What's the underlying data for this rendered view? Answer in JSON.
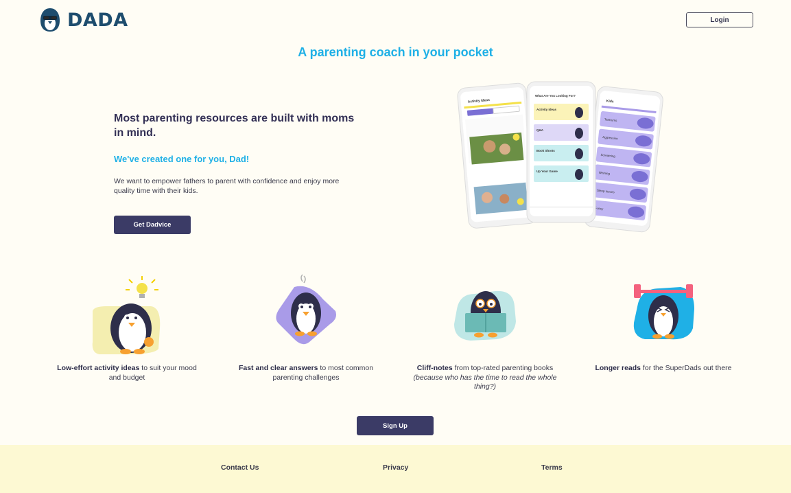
{
  "header": {
    "logo_text": "DADA",
    "login_label": "Login"
  },
  "tagline": "A parenting coach in your pocket",
  "hero": {
    "title": "Most parenting resources are built with moms in mind.",
    "subtitle": "We've created one for you, Dad!",
    "description": "We want to empower fathers to parent with confidence and enjoy more quality time with their kids.",
    "cta_label": "Get Dadvice"
  },
  "phones": {
    "screen1_title": "Activity Ideas",
    "screen2_title": "What Are You Looking For?",
    "screen3_title": "Kids",
    "screen2_items": [
      "Activity Ideas",
      "Q&A",
      "Book Shorts",
      "Up Your Game"
    ],
    "screen3_items": [
      "Tantrums",
      "Aggression",
      "Screaming",
      "Whining",
      "Sleep Issues",
      "Fussy"
    ]
  },
  "features": [
    {
      "bold": "Low-effort activity ideas",
      "text": " to suit your mood and budget",
      "italic": ""
    },
    {
      "bold": "Fast and clear answers",
      "text": " to most common parenting challenges",
      "italic": ""
    },
    {
      "bold": "Cliff-notes",
      "text": " from top-rated parenting books ",
      "italic": "(because who has the time to read the whole thing?)"
    },
    {
      "bold": "Longer reads",
      "text": " for the SuperDads out there",
      "italic": ""
    }
  ],
  "signup_label": "Sign Up",
  "footer": {
    "contact": "Contact Us",
    "privacy": "Privacy",
    "terms": "Terms"
  },
  "colors": {
    "background": "#fffdf5",
    "accent_blue": "#1fb0e6",
    "button_navy": "#3b3b66",
    "footer_bg": "#fdf9d3",
    "logo_blue": "#1e4d6e"
  }
}
